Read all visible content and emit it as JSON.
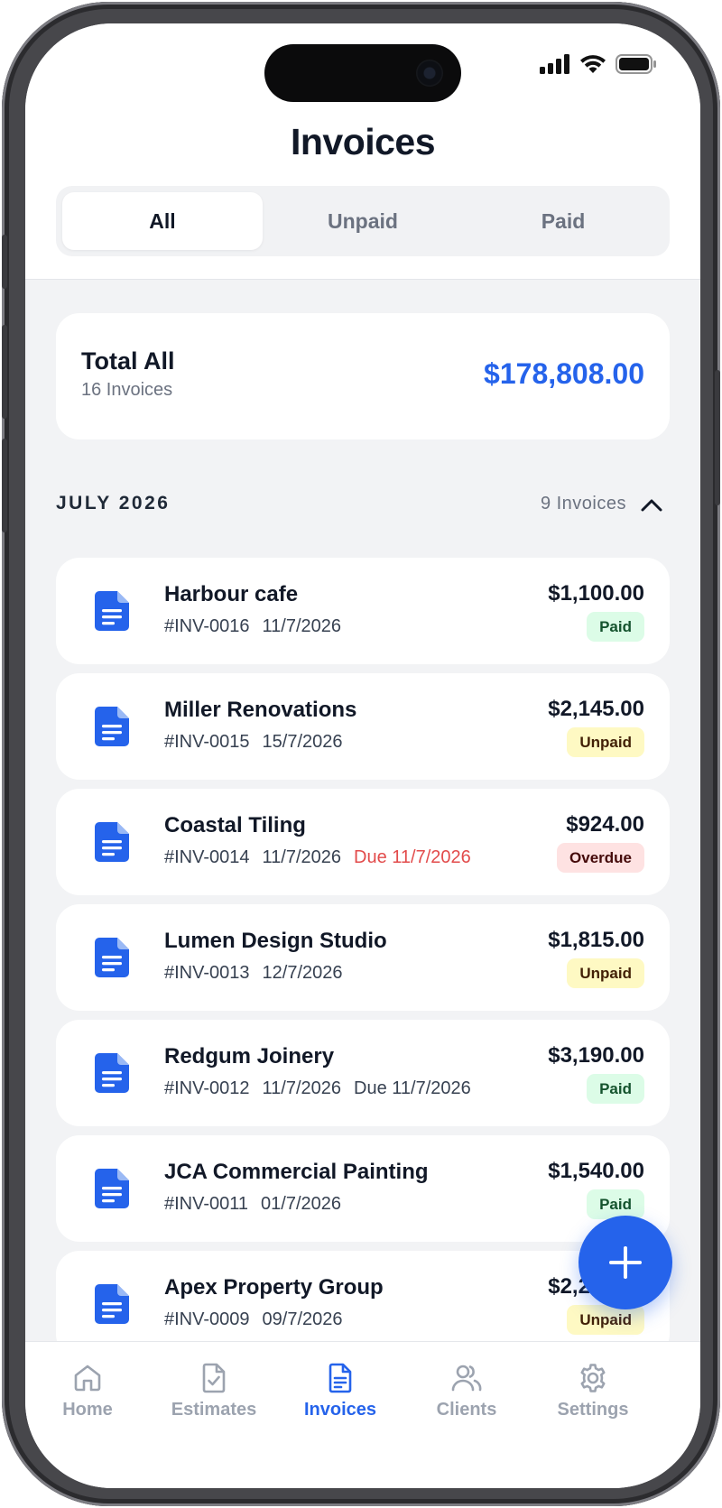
{
  "header": {
    "title": "Invoices",
    "filters": [
      "All",
      "Unpaid",
      "Paid"
    ],
    "active_filter": "All"
  },
  "summary": {
    "title": "Total All",
    "count_text": "16 Invoices",
    "amount": "$178,808.00"
  },
  "section": {
    "title": "JULY 2026",
    "count_text": "9 Invoices"
  },
  "invoices": [
    {
      "client": "Harbour cafe",
      "number": "#INV-0016",
      "date": "11/7/2026",
      "due": "",
      "amount": "$1,100.00",
      "status": "Paid"
    },
    {
      "client": "Miller Renovations",
      "number": "#INV-0015",
      "date": "15/7/2026",
      "due": "",
      "amount": "$2,145.00",
      "status": "Unpaid"
    },
    {
      "client": "Coastal Tiling",
      "number": "#INV-0014",
      "date": "11/7/2026",
      "due": "Due 11/7/2026",
      "amount": "$924.00",
      "status": "Overdue"
    },
    {
      "client": "Lumen Design Studio",
      "number": "#INV-0013",
      "date": "12/7/2026",
      "due": "",
      "amount": "$1,815.00",
      "status": "Unpaid"
    },
    {
      "client": "Redgum Joinery",
      "number": "#INV-0012",
      "date": "11/7/2026",
      "due": "Due 11/7/2026",
      "amount": "$3,190.00",
      "status": "Paid"
    },
    {
      "client": "JCA Commercial Painting",
      "number": "#INV-0011",
      "date": "01/7/2026",
      "due": "",
      "amount": "$1,540.00",
      "status": "Paid"
    },
    {
      "client": "Apex Property Group",
      "number": "#INV-0009",
      "date": "09/7/2026",
      "due": "",
      "amount": "$2,200.00",
      "status": "Unpaid"
    }
  ],
  "tabs": [
    {
      "label": "Home",
      "icon": "home-icon"
    },
    {
      "label": "Estimates",
      "icon": "estimate-icon"
    },
    {
      "label": "Invoices",
      "icon": "invoice-icon"
    },
    {
      "label": "Clients",
      "icon": "clients-icon"
    },
    {
      "label": "Settings",
      "icon": "settings-icon"
    }
  ],
  "active_tab": "Invoices",
  "colors": {
    "accent": "#2563eb",
    "overdue_text": "#e24b4b",
    "paid_badge": "#dcfce7",
    "unpaid_badge": "#fef9c3",
    "overdue_badge": "#fee2e2"
  }
}
